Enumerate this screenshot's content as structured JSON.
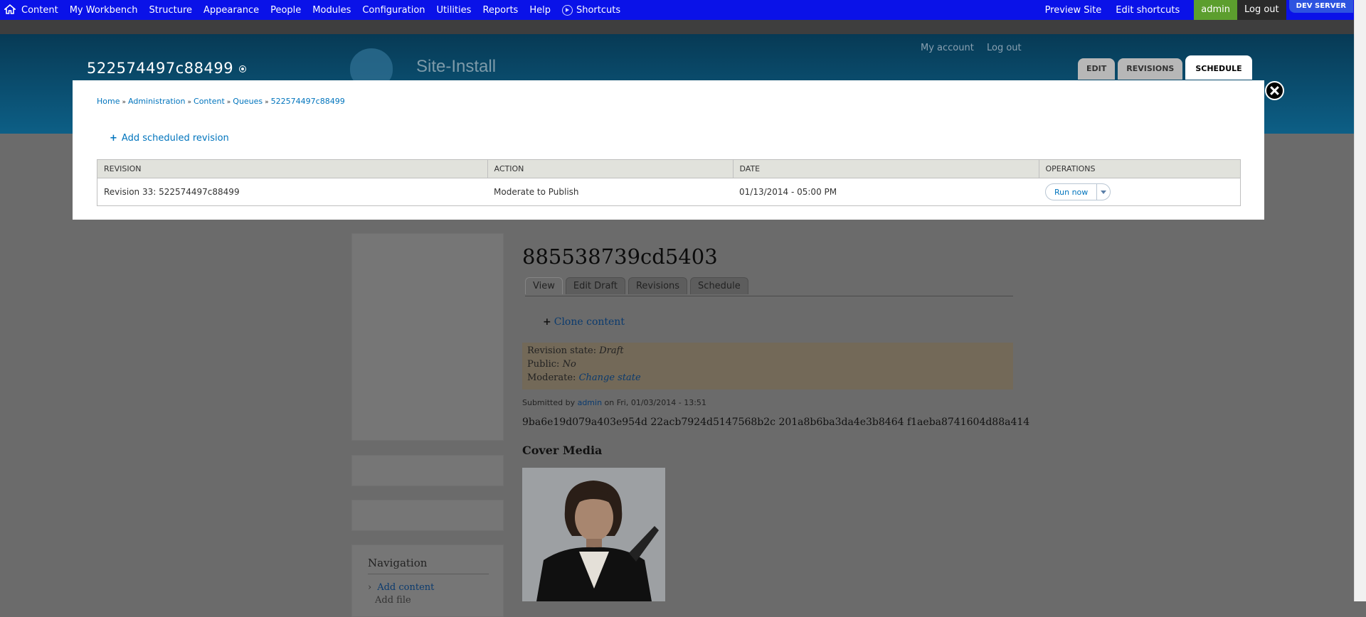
{
  "toolbar": {
    "items": [
      "Content",
      "My Workbench",
      "Structure",
      "Appearance",
      "People",
      "Modules",
      "Configuration",
      "Utilities",
      "Reports",
      "Help",
      "Shortcuts"
    ],
    "preview_site": "Preview Site",
    "edit_shortcuts": "Edit shortcuts",
    "user": "admin",
    "logout": "Log out",
    "env_badge": "DEV SERVER"
  },
  "header": {
    "my_account": "My account",
    "log_out": "Log out",
    "site_name": "Site-Install",
    "node_title": "522574497c88499",
    "tabs": [
      "EDIT",
      "REVISIONS",
      "SCHEDULE"
    ],
    "active_tab": "SCHEDULE"
  },
  "overlay": {
    "breadcrumb": [
      "Home",
      "Administration",
      "Content",
      "Queues",
      "522574497c88499"
    ],
    "add_link": "Add scheduled revision",
    "table": {
      "headers": [
        "REVISION",
        "ACTION",
        "DATE",
        "OPERATIONS"
      ],
      "rows": [
        {
          "revision": "Revision 33: 522574497c88499",
          "action": "Moderate to Publish",
          "date": "01/13/2014 - 05:00 PM",
          "operation": "Run now"
        }
      ]
    }
  },
  "page": {
    "title": "885538739cd5403",
    "tabs": [
      "View",
      "Edit Draft",
      "Revisions",
      "Schedule"
    ],
    "clone_link": "Clone content",
    "revision_state_label": "Revision state:",
    "revision_state_value": "Draft",
    "public_label": "Public:",
    "public_value": "No",
    "moderate_label": "Moderate:",
    "moderate_value": "Change state",
    "submitted_by": "Submitted by",
    "submitted_user": "admin",
    "submitted_on": "on Fri, 01/03/2014 - 13:51",
    "hash_text": "9ba6e19d079a403e954d 22acb7924d5147568b2c 201a8b6ba3da4e3b8464 f1aeba8741604d88a414",
    "cover_media_title": "Cover Media",
    "nav_title": "Navigation",
    "nav_item": "Add content",
    "nav_item2": "Add file"
  },
  "colors": {
    "toolbar_bg": "#0a12e8",
    "admin_bg": "#5c9e2e",
    "link": "#0074bd"
  }
}
